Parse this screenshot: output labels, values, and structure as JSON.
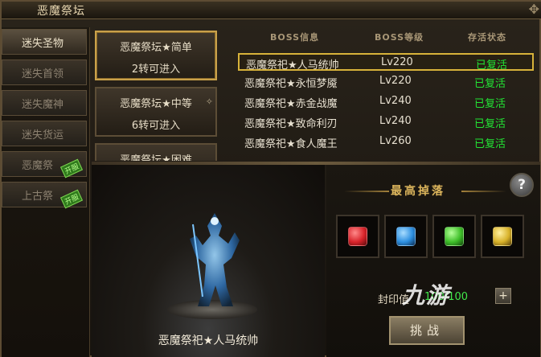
{
  "window": {
    "title": "恶魔祭坛"
  },
  "side_tabs": [
    {
      "label": "迷失圣物",
      "active": true,
      "hot": false
    },
    {
      "label": "迷失首领",
      "active": false,
      "hot": false
    },
    {
      "label": "迷失魔神",
      "active": false,
      "hot": false
    },
    {
      "label": "迷失货运",
      "active": false,
      "hot": false
    },
    {
      "label": "恶魔祭",
      "active": false,
      "hot": true,
      "badge": "开服"
    },
    {
      "label": "上古祭",
      "active": false,
      "hot": true,
      "badge": "开服"
    }
  ],
  "difficulties": [
    {
      "name": "恶魔祭坛★简单",
      "requirement": "2转可进入",
      "active": true
    },
    {
      "name": "恶魔祭坛★中等",
      "requirement": "6转可进入",
      "active": false
    },
    {
      "name": "恶魔祭坛★困难",
      "requirement": "",
      "active": false
    }
  ],
  "boss_table": {
    "headers": {
      "info": "BOSS信息",
      "level": "BOSS等级",
      "status": "存活状态"
    },
    "rows": [
      {
        "name": "恶魔祭祀★人马统帅",
        "level": "Lv220",
        "status": "已复活",
        "selected": true
      },
      {
        "name": "恶魔祭祀★永恒梦魇",
        "level": "Lv220",
        "status": "已复活",
        "selected": false
      },
      {
        "name": "恶魔祭祀★赤金战魔",
        "level": "Lv240",
        "status": "已复活",
        "selected": false
      },
      {
        "name": "恶魔祭祀★致命利刃",
        "level": "Lv240",
        "status": "已复活",
        "selected": false
      },
      {
        "name": "恶魔祭祀★食人魔王",
        "level": "Lv260",
        "status": "已复活",
        "selected": false
      }
    ]
  },
  "stage": {
    "boss_name": "恶魔祭祀★人马统帅"
  },
  "drops": {
    "title": "最高掉落",
    "help_label": "?",
    "items": [
      {
        "icon": "red-gem-icon",
        "color": "#d8232a"
      },
      {
        "icon": "blue-gem-icon",
        "color": "#2d8fe0"
      },
      {
        "icon": "green-gem-icon",
        "color": "#3fbf2a"
      },
      {
        "icon": "yellow-gem-icon",
        "color": "#d8b22a"
      }
    ],
    "seal_label": "封印值",
    "seal_value": "100/100",
    "plus_label": "+",
    "challenge_label": "挑战"
  },
  "watermark": "九游"
}
